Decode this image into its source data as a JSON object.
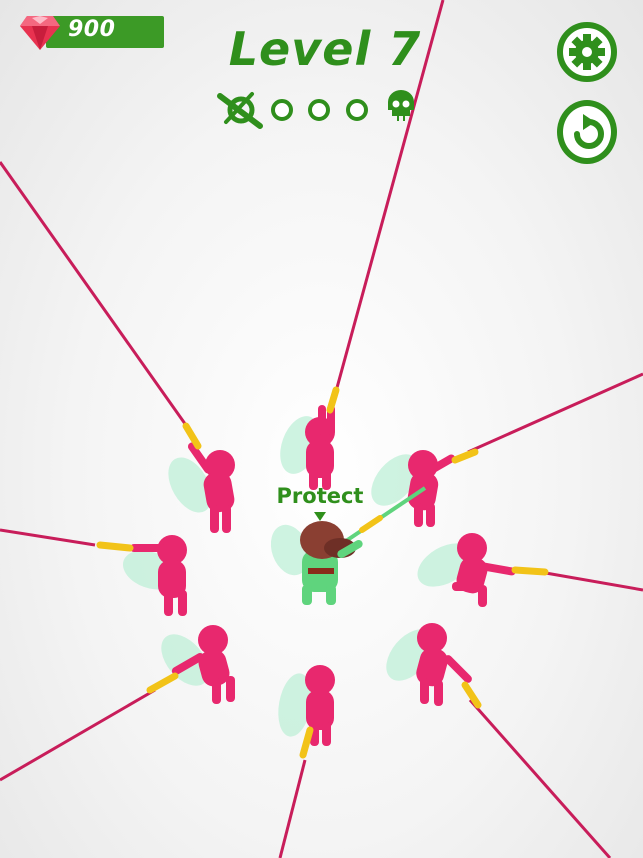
{
  "hud": {
    "gems": "900",
    "level_title": "Level 7",
    "protect_label": "Protect"
  },
  "progress": {
    "stages": [
      "done",
      "pending",
      "pending",
      "pending",
      "boss"
    ],
    "current_stage_icon": "sword-slash-icon",
    "boss_icon": "skull-icon"
  },
  "buttons": {
    "settings_icon": "gear-icon",
    "restart_icon": "restart-icon"
  },
  "colors": {
    "accent": "#2f8f1c",
    "enemy": "#e8286e",
    "player": "#5fd47d",
    "rope": "#c81d5a",
    "gem": "#e83250",
    "weapon": "#f2c318"
  }
}
